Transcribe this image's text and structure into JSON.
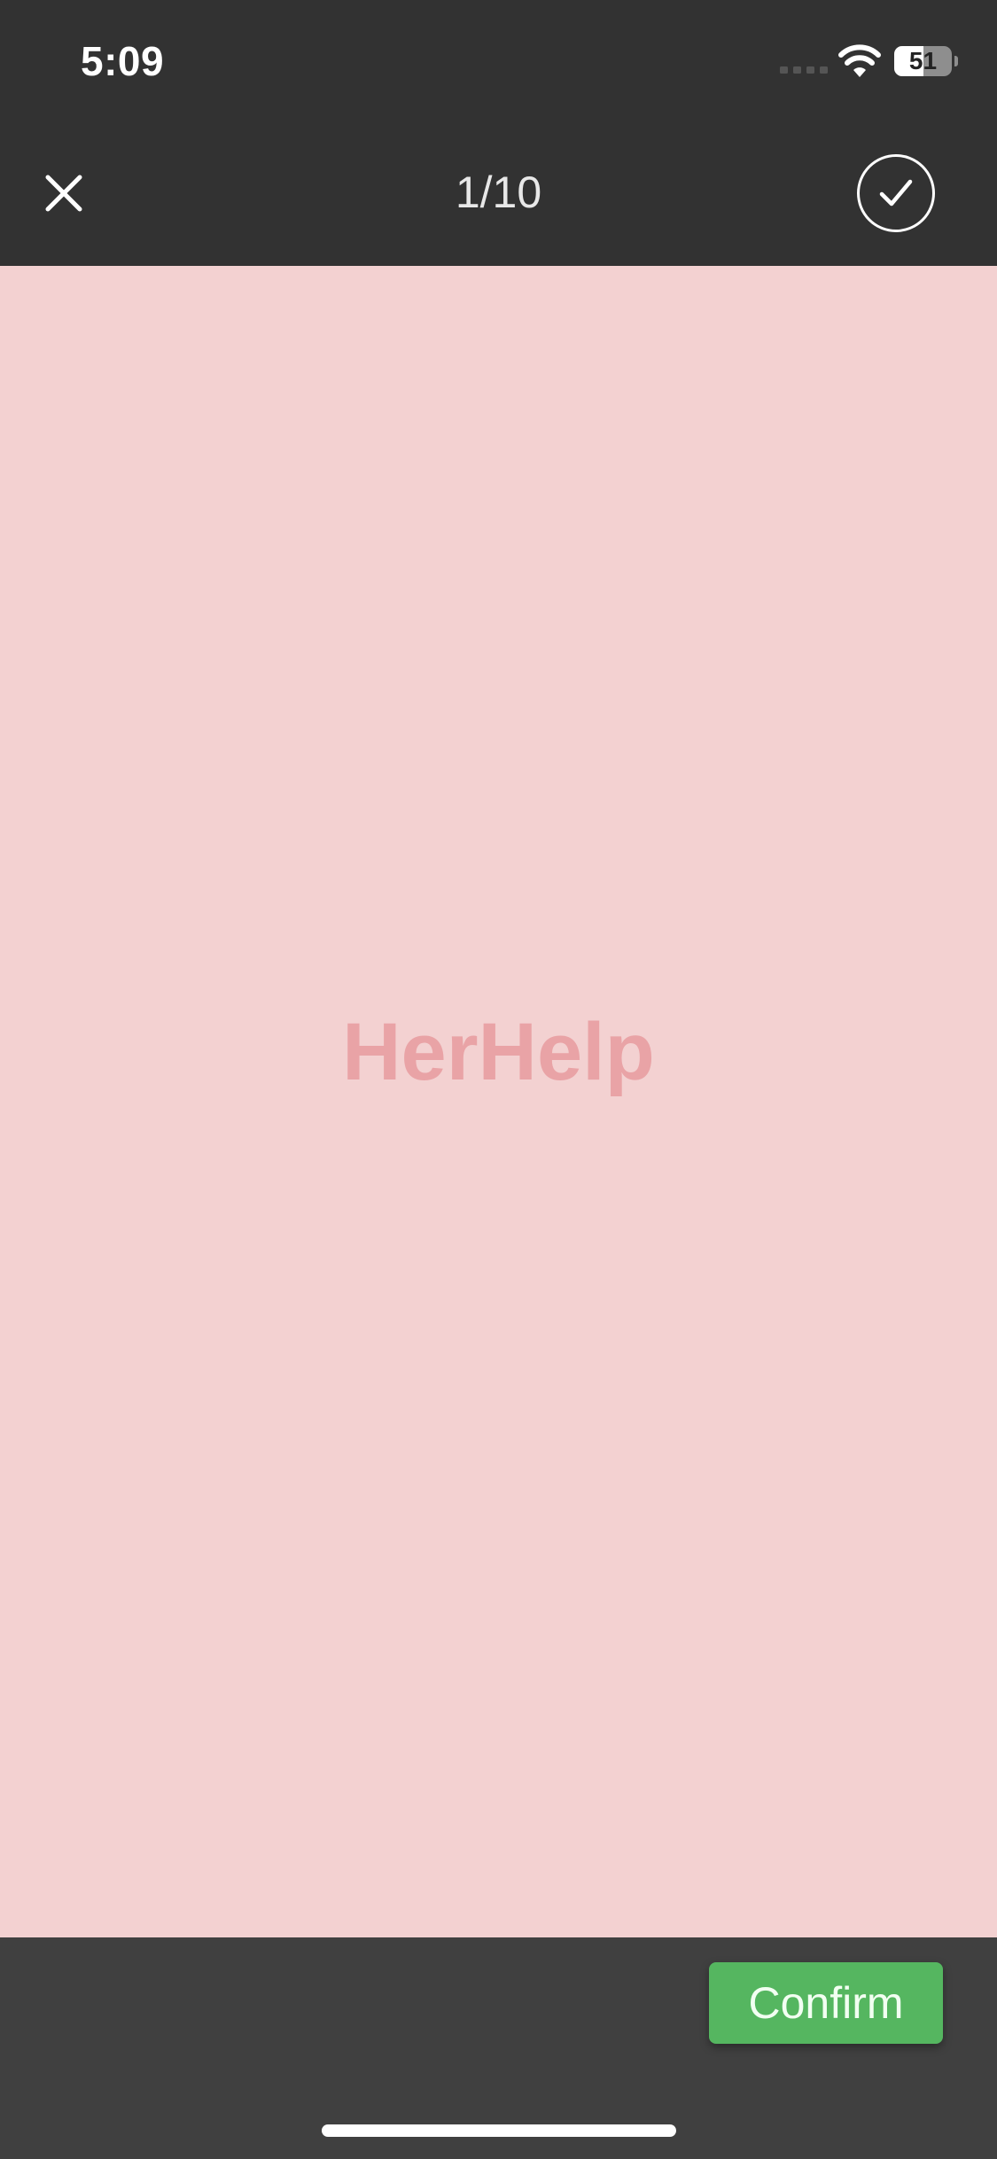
{
  "status_bar": {
    "time": "5:09",
    "battery_level": "51",
    "battery_fraction": 0.51,
    "icons": [
      "signal-icon",
      "wifi-icon",
      "battery-icon"
    ]
  },
  "nav_bar": {
    "close_icon": "close-icon",
    "title": "1/10",
    "done_icon": "checkmark-icon"
  },
  "preview": {
    "brand_text": "HerHelp",
    "background_color": "#f3d1d1",
    "brand_color": "#e9a3a6"
  },
  "bottom_bar": {
    "confirm_label": "Confirm",
    "confirm_color": "#55b660"
  }
}
